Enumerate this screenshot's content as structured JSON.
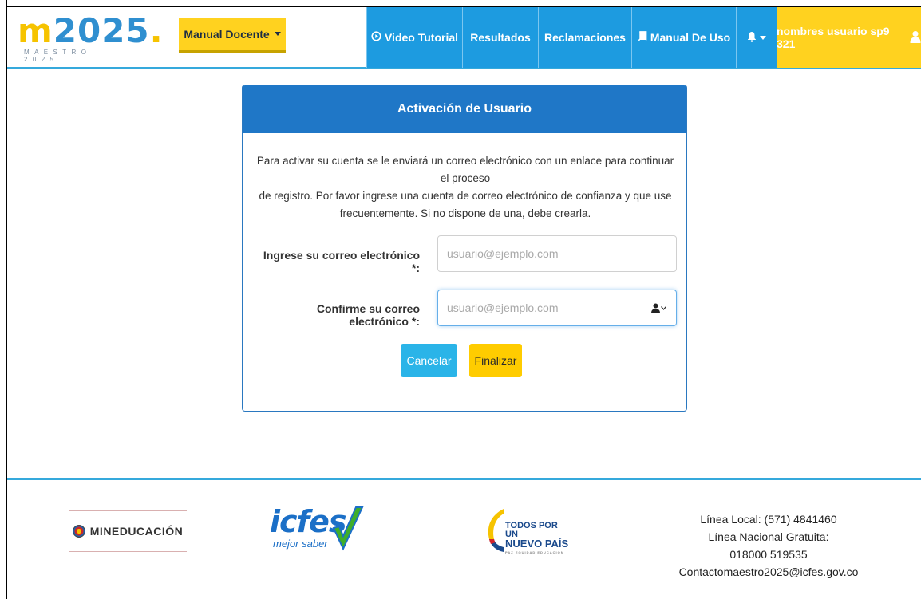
{
  "header": {
    "logo": {
      "main_m": "m",
      "main_num": "2025",
      "main_dot": ".",
      "sub": "MAESTRO 2025"
    },
    "manual_docente": "Manual Docente",
    "nav": {
      "video": "Video Tutorial",
      "resultados": "Resultados",
      "reclamaciones": "Reclamaciones",
      "manual": "Manual De Uso",
      "user": "nombres usuario sp9 321"
    }
  },
  "panel": {
    "title": "Activación de Usuario",
    "description_1": "Para activar su cuenta se le enviará un correo electrónico con un enlace para continuar el proceso",
    "description_2": "de registro. Por favor ingrese una cuenta de correo electrónico de confianza y que use",
    "description_3": "frecuentemente. Si no dispone de una, debe crearla.",
    "email_label": "Ingrese su correo electrónico *:",
    "email_placeholder": "usuario@ejemplo.com",
    "email_value": "",
    "confirm_label": "Confirme su correo electrónico *:",
    "confirm_placeholder": "usuario@ejemplo.com",
    "confirm_value": "",
    "cancel": "Cancelar",
    "finish": "Finalizar"
  },
  "footer": {
    "mineducacion": "MINEDUCACIÓN",
    "icfes": "icfes",
    "icfes_sub": "mejor saber",
    "todos_1": "TODOS POR UN",
    "todos_2": "NUEVO PAÍS",
    "todos_3": "PAZ   EQUIDAD   EDUCACIÓN",
    "contact_1": "Línea Local: (571) 4841460",
    "contact_2": "Línea Nacional Gratuita:",
    "contact_3": "018000 519535",
    "contact_4": "Contactomaestro2025@icfes.gov.co"
  },
  "colors": {
    "nav_blue": "#1d9be0",
    "brand_yellow": "#ffd21f",
    "panel_blue": "#1f77c7",
    "accent_line": "#35a9dc"
  },
  "icons": [
    "play-circle-icon",
    "book-icon",
    "bell-icon",
    "user-icon",
    "chevron-down-icon",
    "contact-card-icon"
  ]
}
